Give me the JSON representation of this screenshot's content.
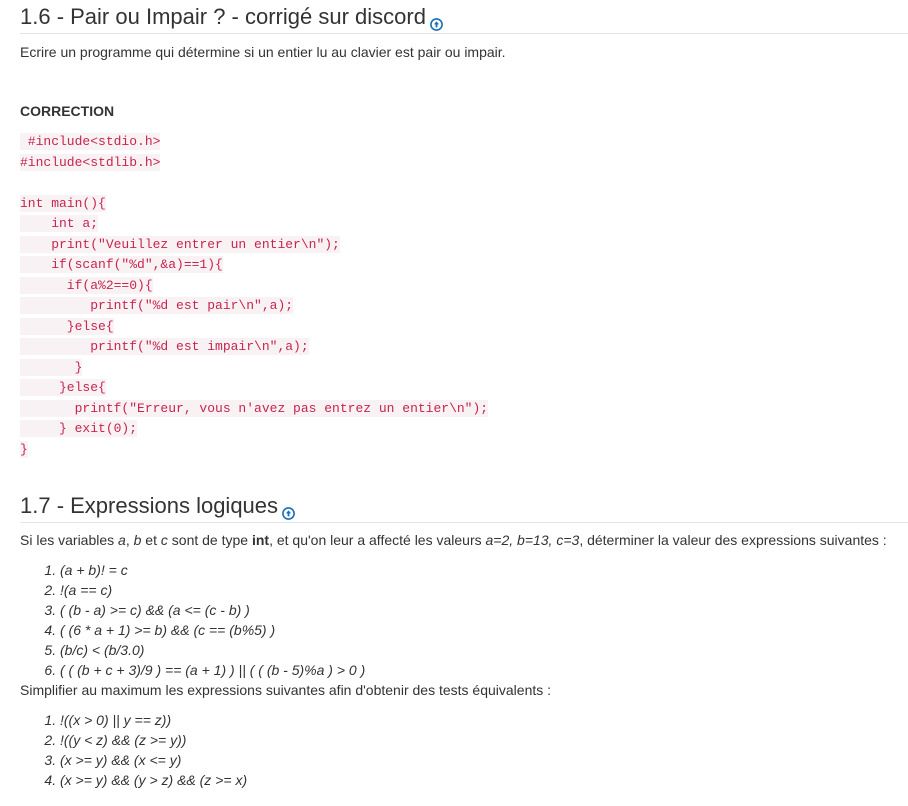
{
  "section1": {
    "title": "1.6 - Pair ou Impair ? - corrigé sur discord",
    "intro": "Ecrire un programme qui détermine si un entier lu au clavier est pair ou impair.",
    "correction_label": "CORRECTION",
    "code_lines": [
      " #include<stdio.h>",
      "#include<stdlib.h>",
      "",
      "int main(){",
      "    int a;",
      "    print(\"Veuillez entrer un entier\\n\");",
      "    if(scanf(\"%d\",&a)==1){",
      "      if(a%2==0){",
      "         printf(\"%d est pair\\n\",a);",
      "      }else{",
      "         printf(\"%d est impair\\n\",a);",
      "       }",
      "     }else{",
      "       printf(\"Erreur, vous n'avez pas entrez un entier\\n\");",
      "     } exit(0);",
      "}"
    ]
  },
  "section2": {
    "title": "1.7 - Expressions logiques",
    "intro_parts": {
      "p1": "Si les variables ",
      "a": "a",
      "p2": ", ",
      "b": "b",
      "p3": " et ",
      "c": "c",
      "p4": " sont de type ",
      "int": "int",
      "p5": ", et qu'on leur a affecté les valeurs ",
      "vals": "a=2, b=13, c=3",
      "p6": ", déterminer la valeur des expressions suivantes :"
    },
    "expressions": [
      "(a + b)! = c",
      "!(a == c)",
      "( (b - a) >= c) && (a <= (c - b) )",
      "( (6 * a + 1) >= b) && (c == (b%5) )",
      "(b/c) < (b/3.0)",
      "( ( (b + c + 3)/9 ) == (a + 1) ) || ( ( (b - 5)%a ) > 0 )"
    ],
    "simplify_text": "Simplifier au maximum les expressions suivantes afin d'obtenir des tests équivalents :",
    "simplify_expressions": [
      "!((x > 0) || y == z))",
      "!((y < z) && (z >= y))",
      "(x >= y) && (x <= y)",
      "(x >= y) && (y > z) && (z >= x)"
    ]
  },
  "colors": {
    "icon": "#1a6fb8",
    "code_text": "#c7254e",
    "code_bg": "#f9f2f4"
  }
}
